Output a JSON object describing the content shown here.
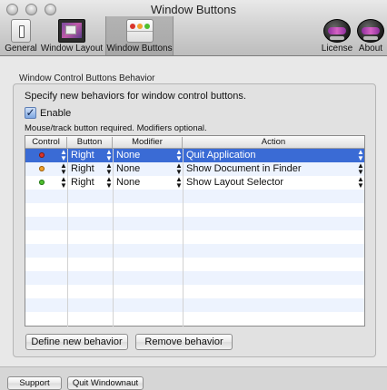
{
  "window": {
    "title": "Window Buttons"
  },
  "toolbar": {
    "items": [
      {
        "label": "General",
        "icon": "general-prefs-icon"
      },
      {
        "label": "Window Layout",
        "icon": "window-layout-icon"
      },
      {
        "label": "Window Buttons",
        "icon": "window-buttons-icon",
        "selected": true
      },
      {
        "label": "License",
        "icon": "helmet-icon"
      },
      {
        "label": "About",
        "icon": "helmet-icon"
      }
    ]
  },
  "section": {
    "title": "Window Control Buttons Behavior",
    "description": "Specify new behaviors for window control buttons.",
    "enable_label": "Enable",
    "enable_checked": true,
    "hint": "Mouse/track button required. Modifiers optional."
  },
  "table": {
    "columns": [
      "Control",
      "Button",
      "Modifier",
      "Action"
    ],
    "rows": [
      {
        "control_color": "#d9342b",
        "button": "Right",
        "modifier": "None",
        "action": "Quit Application",
        "selected": true
      },
      {
        "control_color": "#f0a12c",
        "button": "Right",
        "modifier": "None",
        "action": "Show Document in Finder",
        "selected": false
      },
      {
        "control_color": "#4fbf2e",
        "button": "Right",
        "modifier": "None",
        "action": "Show Layout Selector",
        "selected": false
      }
    ]
  },
  "actions": {
    "define_label": "Define new behavior",
    "remove_label": "Remove behavior"
  },
  "footer": {
    "support_label": "Support",
    "quit_label": "Quit Windownaut"
  },
  "colors": {
    "selection": "#3a6bd5",
    "close": "#d9342b",
    "minimize": "#f0a12c",
    "zoom": "#4fbf2e"
  }
}
